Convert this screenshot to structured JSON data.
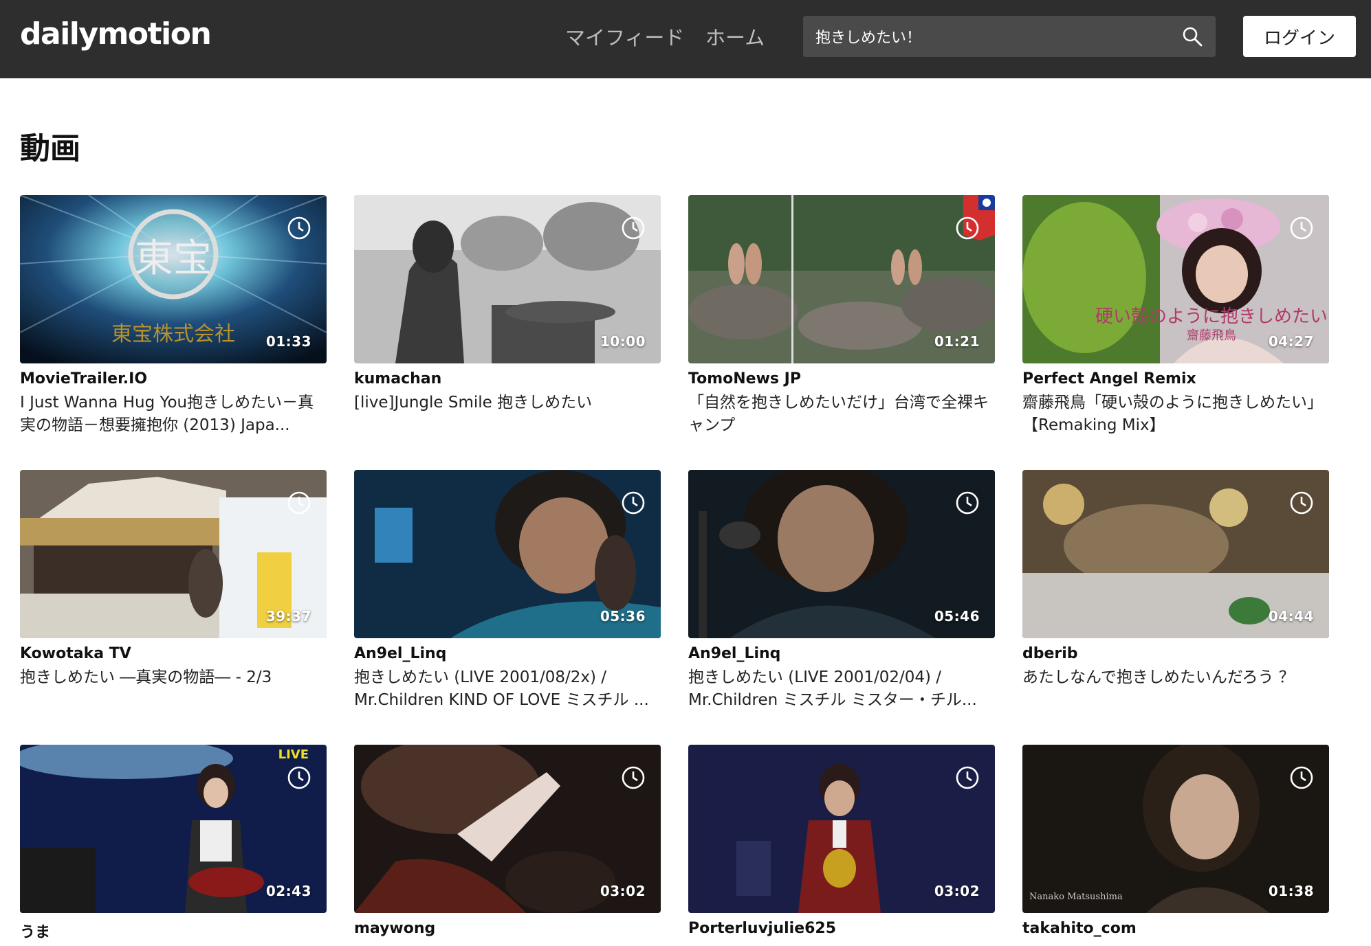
{
  "header": {
    "logo": "dailymotion",
    "nav": [
      "マイフィード",
      "ホーム"
    ],
    "search_value": "抱きしめたい！",
    "login_label": "ログイン"
  },
  "section_title": "動画",
  "videos": [
    {
      "channel": "MovieTrailer.IO",
      "title": "I Just Wanna Hug You抱きしめたい－真実の物語－想要擁抱你 (2013) Japa...",
      "duration": "01:33"
    },
    {
      "channel": "kumachan",
      "title": "[live]Jungle Smile 抱きしめたい",
      "duration": "10:00"
    },
    {
      "channel": "TomoNews JP",
      "title": "「自然を抱きしめたいだけ」台湾で全裸キャンプ",
      "duration": "01:21"
    },
    {
      "channel": "Perfect Angel Remix",
      "title": "齋藤飛鳥「硬い殻のように抱きしめたい」【Remaking Mix】",
      "duration": "04:27"
    },
    {
      "channel": "Kowotaka TV",
      "title": "抱きしめたい ―真実の物語― - 2/3",
      "duration": "39:37"
    },
    {
      "channel": "An9el_Linq",
      "title": "抱きしめたい (LIVE 2001/08/2x) / Mr.Children KIND OF LOVE ミスチル ...",
      "duration": "05:36"
    },
    {
      "channel": "An9el_Linq",
      "title": "抱きしめたい (LIVE 2001/02/04) / Mr.Children ミスチル ミスター・チル...",
      "duration": "05:46"
    },
    {
      "channel": "dberib",
      "title": "あたしなんで抱きしめたいんだろう ？",
      "duration": "04:44"
    },
    {
      "channel": "うま",
      "title": "",
      "duration": "02:43"
    },
    {
      "channel": "maywong",
      "title": "",
      "duration": "03:02"
    },
    {
      "channel": "Porterluvjulie625",
      "title": "",
      "duration": "03:02"
    },
    {
      "channel": "takahito_com",
      "title": "",
      "duration": "01:38"
    }
  ],
  "thumb_text": {
    "v0_logo": "東宝",
    "v0_company": "東宝株式会社",
    "v3_overlay": "硬い殻のように抱きしめたい",
    "v3_name": "齋藤飛鳥",
    "v8_live": "LIVE",
    "v11_name": "Nanako Matsushima"
  },
  "colors": {
    "topbar": "#2e2e2e",
    "search_bg": "#4a4a4a",
    "accent_white": "#ffffff"
  }
}
